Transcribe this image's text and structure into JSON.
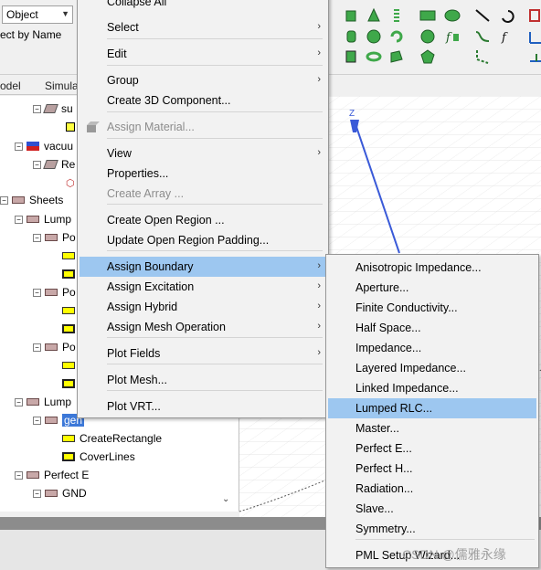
{
  "toolbar": {
    "object_combo": "Object",
    "select_by_name": "ect by Name"
  },
  "panel_tabs": [
    "odel",
    "Simula"
  ],
  "tree": {
    "items": [
      {
        "label": "su"
      },
      {
        "label": "vacuu"
      },
      {
        "label": "Re"
      },
      {
        "label": "Sheets"
      },
      {
        "label": "Lump"
      },
      {
        "label": "Po"
      },
      {
        "label": "Po"
      },
      {
        "label": "Po"
      },
      {
        "label": "Lump"
      },
      {
        "label": "gen"
      },
      {
        "label": "CreateRectangle"
      },
      {
        "label": "CoverLines"
      },
      {
        "label": "Perfect E"
      },
      {
        "label": "GND"
      }
    ]
  },
  "viewport": {
    "axis_label": "Z"
  },
  "context_menu": {
    "items": [
      {
        "label": "Collapse All",
        "disabled": false,
        "submenu": false
      },
      {
        "label": "Select",
        "disabled": false,
        "submenu": true
      },
      {
        "label": "Edit",
        "disabled": false,
        "submenu": true
      },
      {
        "label": "Group",
        "disabled": false,
        "submenu": true
      },
      {
        "label": "Create 3D Component...",
        "disabled": false,
        "submenu": false
      },
      {
        "label": "Assign Material...",
        "disabled": true,
        "submenu": false
      },
      {
        "label": "View",
        "disabled": false,
        "submenu": true
      },
      {
        "label": "Properties...",
        "disabled": false,
        "submenu": false
      },
      {
        "label": "Create Array ...",
        "disabled": true,
        "submenu": false
      },
      {
        "label": "Create Open Region ...",
        "disabled": false,
        "submenu": false
      },
      {
        "label": "Update Open Region Padding...",
        "disabled": false,
        "submenu": false
      },
      {
        "label": "Assign Boundary",
        "disabled": false,
        "submenu": true
      },
      {
        "label": "Assign Excitation",
        "disabled": false,
        "submenu": true
      },
      {
        "label": "Assign Hybrid",
        "disabled": false,
        "submenu": true
      },
      {
        "label": "Assign Mesh Operation",
        "disabled": false,
        "submenu": true
      },
      {
        "label": "Plot Fields",
        "disabled": false,
        "submenu": true
      },
      {
        "label": "Plot Mesh...",
        "disabled": false,
        "submenu": false
      },
      {
        "label": "Plot VRT...",
        "disabled": false,
        "submenu": false
      }
    ],
    "highlighted": "Assign Boundary"
  },
  "boundary_submenu": {
    "items": [
      "Anisotropic Impedance...",
      "Aperture...",
      "Finite Conductivity...",
      "Half Space...",
      "Impedance...",
      "Layered Impedance...",
      "Linked Impedance...",
      "Lumped RLC...",
      "Master...",
      "Perfect E...",
      "Perfect H...",
      "Radiation...",
      "Slave...",
      "Symmetry...",
      "PML Setup Wizard..."
    ],
    "highlighted": "Lumped RLC..."
  },
  "watermark": "CSDN @儒雅永缘",
  "colors": {
    "menu_highlight": "#9dc7f0",
    "selection": "#3c78d8",
    "axis": "#3a5ad8"
  }
}
